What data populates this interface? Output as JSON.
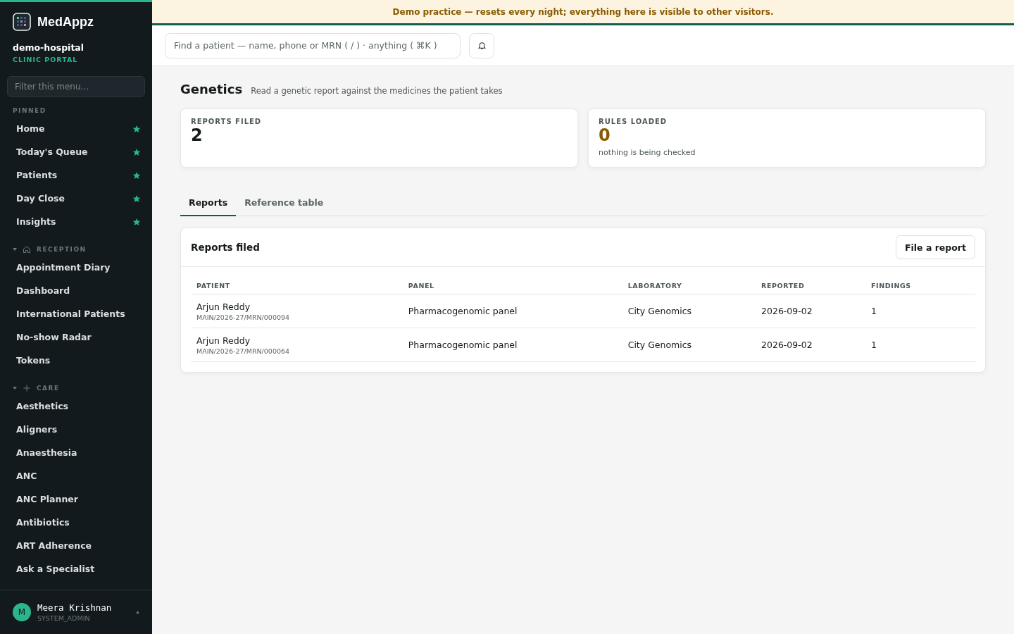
{
  "brand": {
    "name": "MedAppz",
    "org": "demo-hospital",
    "portal": "CLINIC PORTAL"
  },
  "sidebar": {
    "filter_placeholder": "Filter this menu...",
    "pinned": {
      "title": "PINNED",
      "items": [
        {
          "label": "Home",
          "pinned": true
        },
        {
          "label": "Today's Queue",
          "pinned": true
        },
        {
          "label": "Patients",
          "pinned": true
        },
        {
          "label": "Day Close",
          "pinned": true
        },
        {
          "label": "Insights",
          "pinned": true
        }
      ]
    },
    "groups": [
      {
        "title": "RECEPTION",
        "kind": "house",
        "expanded": true,
        "items": [
          "Appointment Diary",
          "Dashboard",
          "International Patients",
          "No-show Radar",
          "Tokens"
        ]
      },
      {
        "title": "CARE",
        "kind": "plus",
        "expanded": true,
        "items": [
          "Aesthetics",
          "Aligners",
          "Anaesthesia",
          "ANC",
          "ANC Planner",
          "Antibiotics",
          "ART Adherence",
          "Ask a Specialist"
        ]
      }
    ],
    "user": {
      "initial": "M",
      "name": "Meera Krishnan",
      "role": "SYSTEM_ADMIN"
    }
  },
  "banner": "Demo practice — resets every night; everything here is visible to other visitors.",
  "search": {
    "placeholder": "Find a patient — name, phone or MRN ( / ) · anything ( ⌘K )"
  },
  "page": {
    "title": "Genetics",
    "subtitle": "Read a genetic report against the medicines the patient takes"
  },
  "stats": [
    {
      "label": "REPORTS FILED",
      "value": "2",
      "color": "#161a1c"
    },
    {
      "label": "RULES LOADED",
      "value": "0",
      "color": "#8a5a00",
      "note": "nothing is being checked"
    }
  ],
  "tabs": [
    {
      "label": "Reports",
      "selected": true
    },
    {
      "label": "Reference table",
      "selected": false
    }
  ],
  "reports": {
    "title": "Reports filed",
    "action": "File a report",
    "columns": [
      "PATIENT",
      "PANEL",
      "LABORATORY",
      "REPORTED",
      "FINDINGS"
    ],
    "rows": [
      {
        "patient": "Arjun Reddy",
        "mrn": "MAIN/2026-27/MRN/000094",
        "panel": "Pharmacogenomic panel",
        "laboratory": "City Genomics",
        "reported": "2026-09-02",
        "findings": "1"
      },
      {
        "patient": "Arjun Reddy",
        "mrn": "MAIN/2026-27/MRN/000064",
        "panel": "Pharmacogenomic panel",
        "laboratory": "City Genomics",
        "reported": "2026-09-02",
        "findings": "1"
      }
    ]
  }
}
